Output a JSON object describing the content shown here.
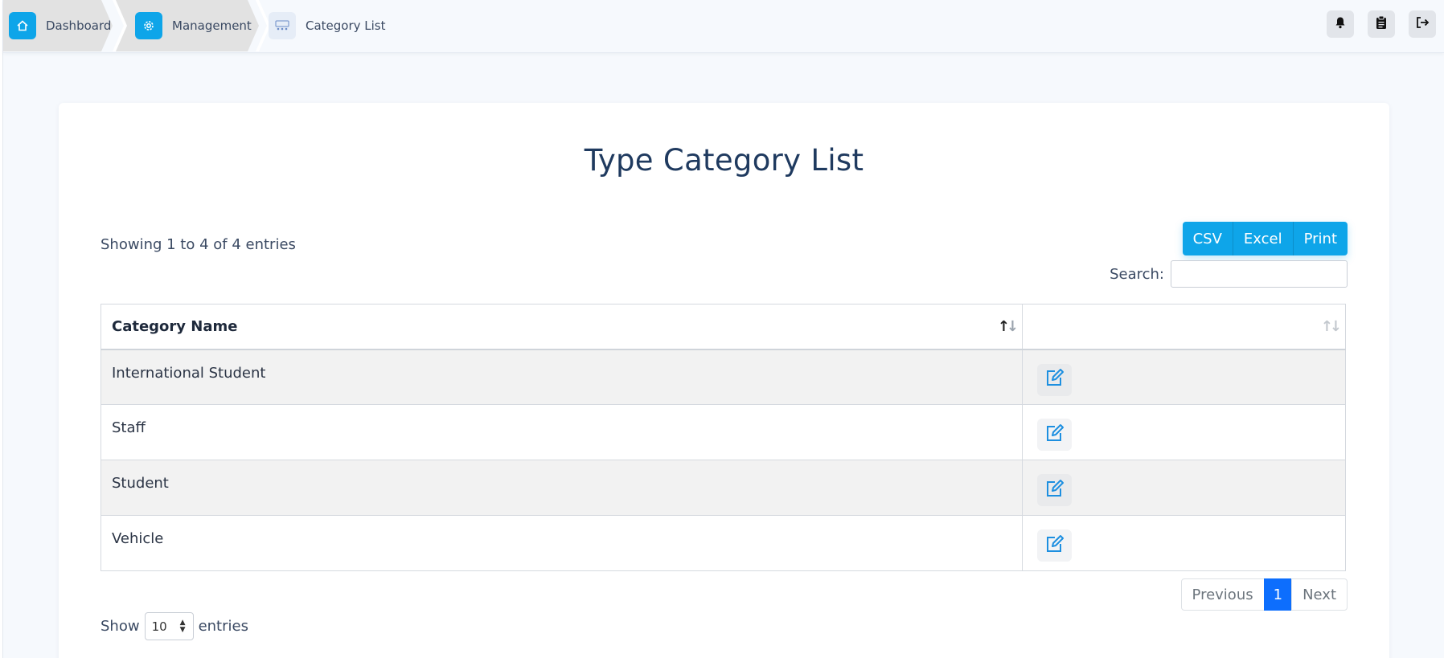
{
  "breadcrumb": {
    "items": [
      {
        "label": "Dashboard",
        "icon": "home-icon"
      },
      {
        "label": "Management",
        "icon": "gear-icon"
      },
      {
        "label": "Category List",
        "icon": "category-list-icon"
      }
    ]
  },
  "top_actions": [
    {
      "icon": "bell-icon"
    },
    {
      "icon": "clipboard-icon"
    },
    {
      "icon": "logout-icon"
    }
  ],
  "page": {
    "title": "Type Category List",
    "showing": "Showing 1 to 4 of 4 entries",
    "export": {
      "csv": "CSV",
      "excel": "Excel",
      "print": "Print"
    },
    "search_label": "Search:",
    "search_value": ""
  },
  "table": {
    "columns": [
      "Category Name",
      ""
    ],
    "rows": [
      {
        "name": "International Student"
      },
      {
        "name": "Staff"
      },
      {
        "name": "Student"
      },
      {
        "name": "Vehicle"
      }
    ]
  },
  "pagination": {
    "previous": "Previous",
    "current": "1",
    "next": "Next"
  },
  "length": {
    "show": "Show",
    "value": "10",
    "entries": "entries"
  },
  "colors": {
    "accent": "#0ea5e9",
    "active_page": "#0d6efd",
    "title": "#1f3a5f"
  }
}
